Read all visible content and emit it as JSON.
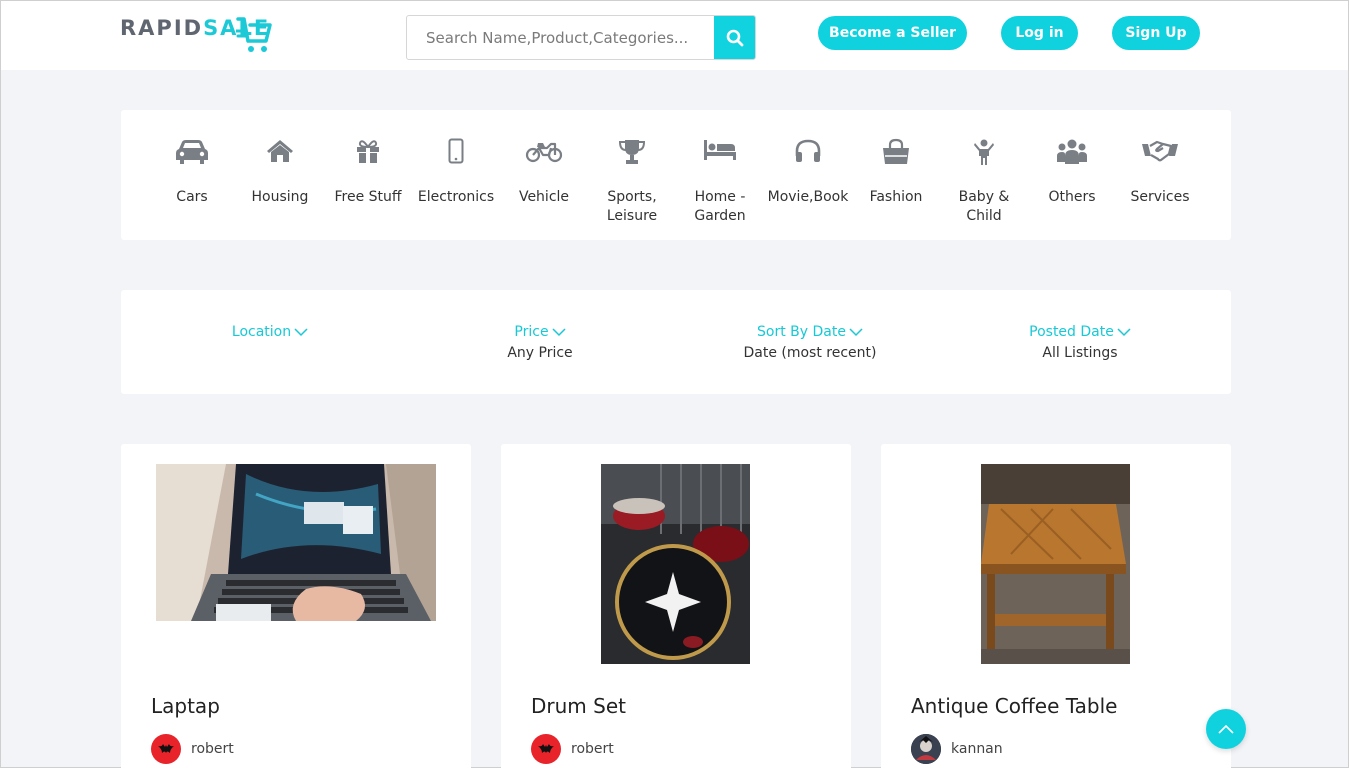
{
  "header": {
    "logo_part1": "RAPID",
    "logo_part2": "SALE",
    "search_placeholder": "Search Name,Product,Categories...",
    "buttons": {
      "seller": "Become a Seller",
      "login": "Log in",
      "signup": "Sign Up"
    }
  },
  "categories": [
    {
      "label": "Cars",
      "icon": "car-icon"
    },
    {
      "label": "Housing",
      "icon": "home-icon"
    },
    {
      "label": "Free Stuff",
      "icon": "gift-icon"
    },
    {
      "label": "Electronics",
      "icon": "mobile-icon"
    },
    {
      "label": "Vehicle",
      "icon": "motorcycle-icon"
    },
    {
      "label": "Sports, Leisure",
      "icon": "trophy-icon"
    },
    {
      "label": "Home - Garden",
      "icon": "bed-icon"
    },
    {
      "label": "Movie,Book",
      "icon": "headphones-icon"
    },
    {
      "label": "Fashion",
      "icon": "shopping-bag-icon"
    },
    {
      "label": "Baby & Child",
      "icon": "child-icon"
    },
    {
      "label": "Others",
      "icon": "users-icon"
    },
    {
      "label": "Services",
      "icon": "handshake-icon"
    }
  ],
  "filters": [
    {
      "title": "Location",
      "value": ""
    },
    {
      "title": "Price",
      "value": "Any Price"
    },
    {
      "title": "Sort By Date",
      "value": "Date (most recent)"
    },
    {
      "title": "Posted Date",
      "value": "All Listings"
    }
  ],
  "listings": [
    {
      "title": "Laptap",
      "author": "robert"
    },
    {
      "title": "Drum Set",
      "author": "robert"
    },
    {
      "title": "Antique Coffee Table",
      "author": "kannan"
    }
  ],
  "colors": {
    "accent": "#10d2de",
    "background": "#f3f4f8",
    "icon_gray": "#7a7f86"
  }
}
